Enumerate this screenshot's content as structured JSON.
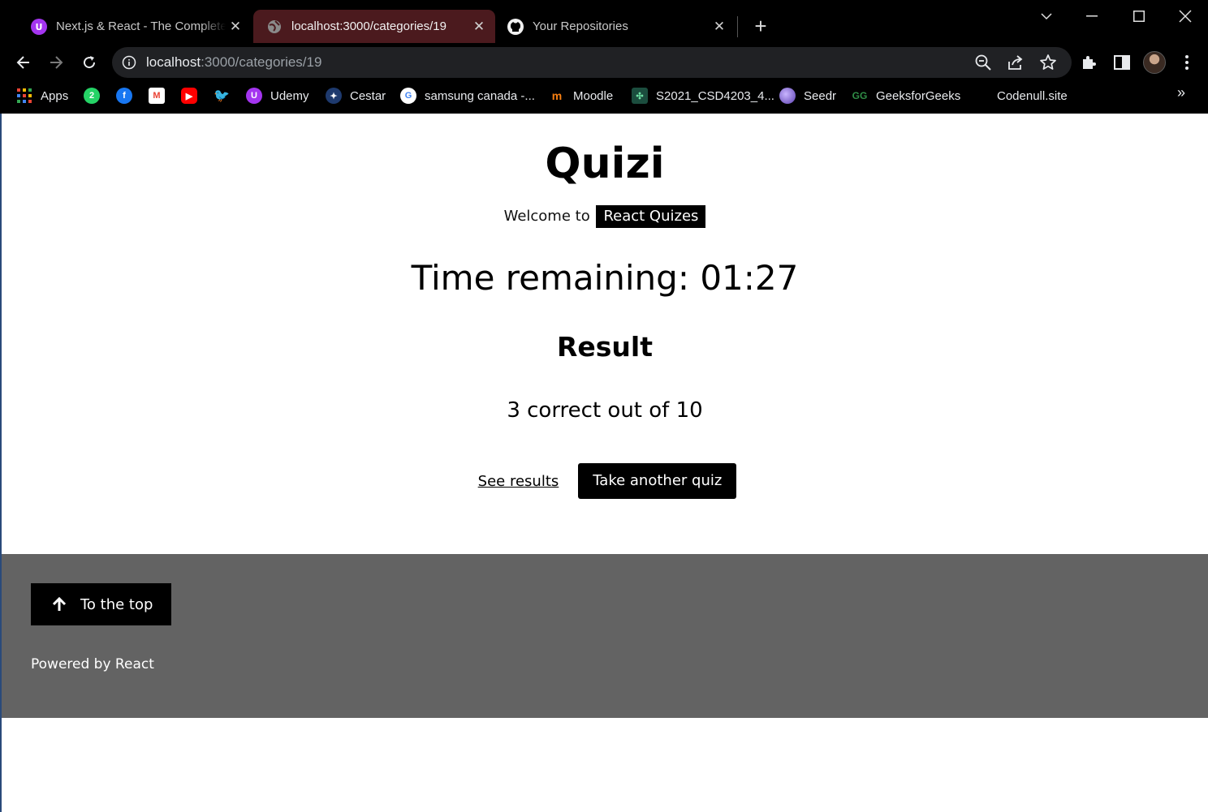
{
  "browser": {
    "tabs": [
      {
        "title": "Next.js & React - The Complete Guide",
        "icon": "udemy-icon",
        "active": false
      },
      {
        "title": "localhost:3000/categories/19",
        "icon": "globe-icon",
        "active": true
      },
      {
        "title": "Your Repositories",
        "icon": "github-icon",
        "active": false
      }
    ],
    "url_host": "localhost",
    "url_path": ":3000/categories/19",
    "bookmarks": [
      {
        "label": "Apps",
        "icon": "apps-grid-icon"
      },
      {
        "label": "",
        "icon": "whatsapp-icon"
      },
      {
        "label": "",
        "icon": "facebook-icon"
      },
      {
        "label": "",
        "icon": "gmail-icon"
      },
      {
        "label": "",
        "icon": "youtube-icon"
      },
      {
        "label": "",
        "icon": "twitter-icon"
      },
      {
        "label": "Udemy",
        "icon": "udemy-icon"
      },
      {
        "label": "Cestar",
        "icon": "cestar-icon"
      },
      {
        "label": "samsung canada -...",
        "icon": "google-icon"
      },
      {
        "label": "Moodle",
        "icon": "moodle-icon"
      },
      {
        "label": "S2021_CSD4203_4...",
        "icon": "course-icon"
      },
      {
        "label": "Seedr",
        "icon": "seedr-icon"
      },
      {
        "label": "GeeksforGeeks",
        "icon": "geeksforgeeks-icon"
      },
      {
        "label": "Codenull.site",
        "icon": ""
      }
    ],
    "colors": {
      "active_tab": "#4b1a1e",
      "chrome_bg": "#000000"
    }
  },
  "app": {
    "title": "Quizi",
    "welcome_prefix": "Welcome to",
    "category_badge": "React Quizes",
    "timer_text": "Time remaining: 01:27",
    "result_heading": "Result",
    "score_text": "3 correct out of 10",
    "see_results_label": "See results",
    "take_another_label": "Take another quiz"
  },
  "footer": {
    "top_button_label": "To the top",
    "powered_by": "Powered by React",
    "background": "#636363"
  }
}
